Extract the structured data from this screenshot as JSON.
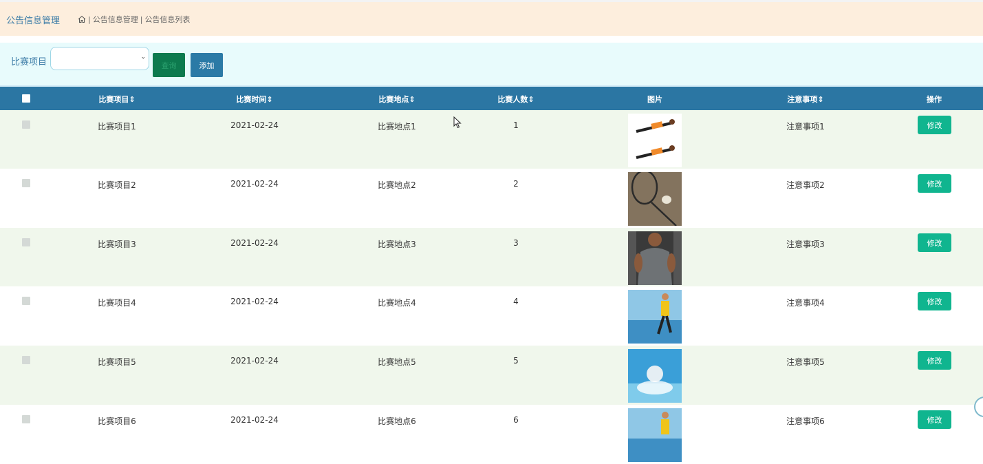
{
  "header": {
    "title": "公告信息管理",
    "breadcrumb": [
      "公告信息管理",
      "公告信息列表"
    ]
  },
  "search": {
    "label": "比赛项目",
    "select_value": "",
    "search_button": "查询",
    "add_button": "添加"
  },
  "table": {
    "columns": [
      "比赛项目",
      "比赛时间",
      "比赛地点",
      "比赛人数",
      "图片",
      "注意事项",
      "操作"
    ],
    "rows": [
      {
        "item": "比赛项目1",
        "time": "2021-02-24",
        "place": "比赛地点1",
        "count": "1",
        "image": "plank-exercise-photo",
        "notes": "注意事项1",
        "action": "修改"
      },
      {
        "item": "比赛项目2",
        "time": "2021-02-24",
        "place": "比赛地点2",
        "count": "2",
        "image": "badminton-racket-photo",
        "notes": "注意事项2",
        "action": "修改"
      },
      {
        "item": "比赛项目3",
        "time": "2021-02-24",
        "place": "比赛地点3",
        "count": "3",
        "image": "gym-athlete-photo",
        "notes": "注意事项3",
        "action": "修改"
      },
      {
        "item": "比赛项目4",
        "time": "2021-02-24",
        "place": "比赛地点4",
        "count": "4",
        "image": "runner-seaside-photo",
        "notes": "注意事项4",
        "action": "修改"
      },
      {
        "item": "比赛项目5",
        "time": "2021-02-24",
        "place": "比赛地点5",
        "count": "5",
        "image": "swimmer-photo",
        "notes": "注意事项5",
        "action": "修改"
      },
      {
        "item": "比赛项目6",
        "time": "2021-02-24",
        "place": "比赛地点6",
        "count": "6",
        "image": "runner-seaside-photo",
        "notes": "注意事项6",
        "action": "修改"
      }
    ]
  },
  "colors": {
    "header_bg": "#fdeedd",
    "search_bg": "#e8fbfc",
    "table_header_bg": "#2b76a3",
    "row_alt_bg": "#f0f7ec",
    "edit_button": "#10b58f",
    "add_button": "#2b7aa6",
    "search_button": "#0d7a4e"
  }
}
